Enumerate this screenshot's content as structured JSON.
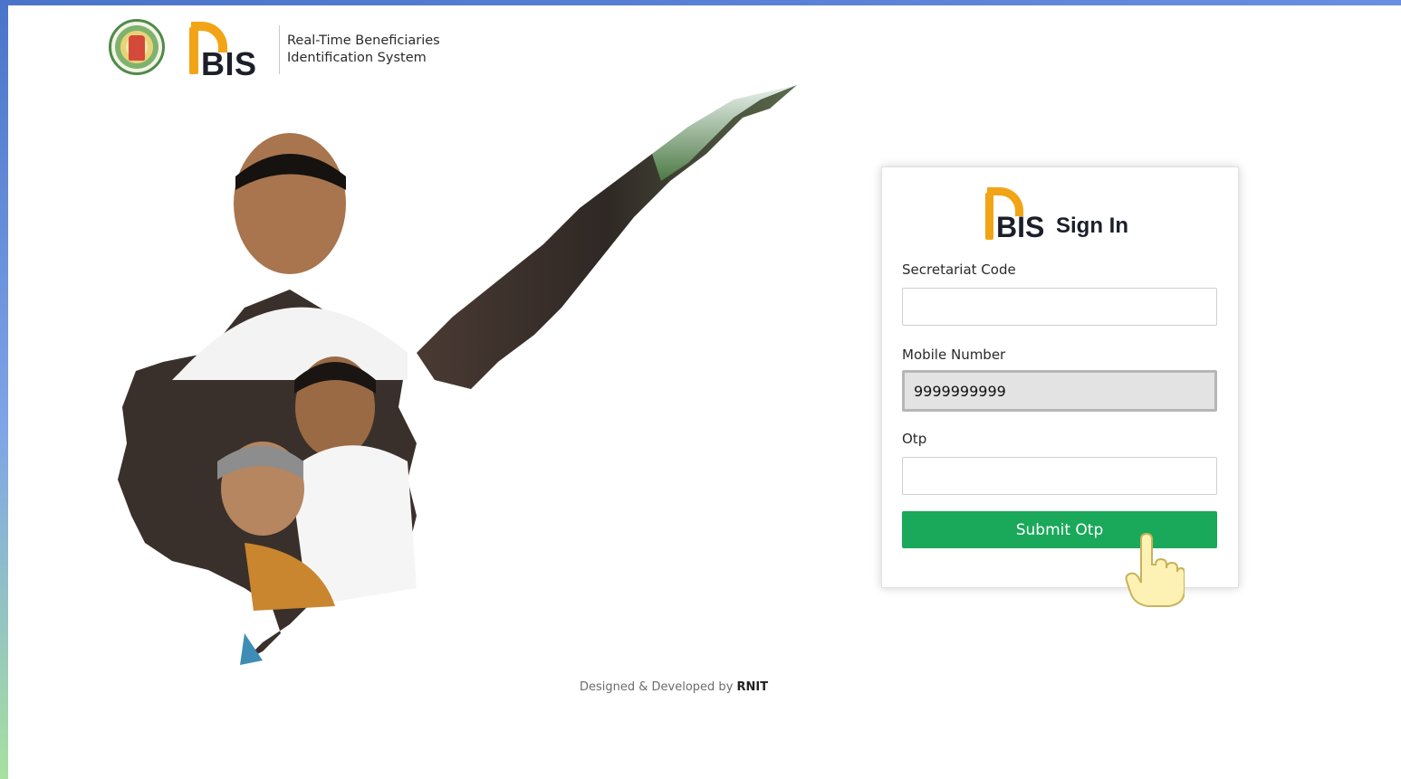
{
  "header": {
    "brand": "BIS",
    "tagline_line1": "Real-Time Beneficiaries",
    "tagline_line2": "Identification System"
  },
  "signin": {
    "brand": "BIS",
    "title": "Sign In",
    "secretariat_label": "Secretariat Code",
    "secretariat_value": "",
    "mobile_label": "Mobile Number",
    "mobile_value": "9999999999",
    "otp_label": "Otp",
    "otp_value": "",
    "submit_label": "Submit Otp"
  },
  "footer": {
    "prefix": "Designed & Developed by",
    "company": "RNIT"
  },
  "colors": {
    "brand_orange": "#f2a417",
    "button_green": "#1aa85a",
    "accent_blue": "#4a74c9"
  }
}
